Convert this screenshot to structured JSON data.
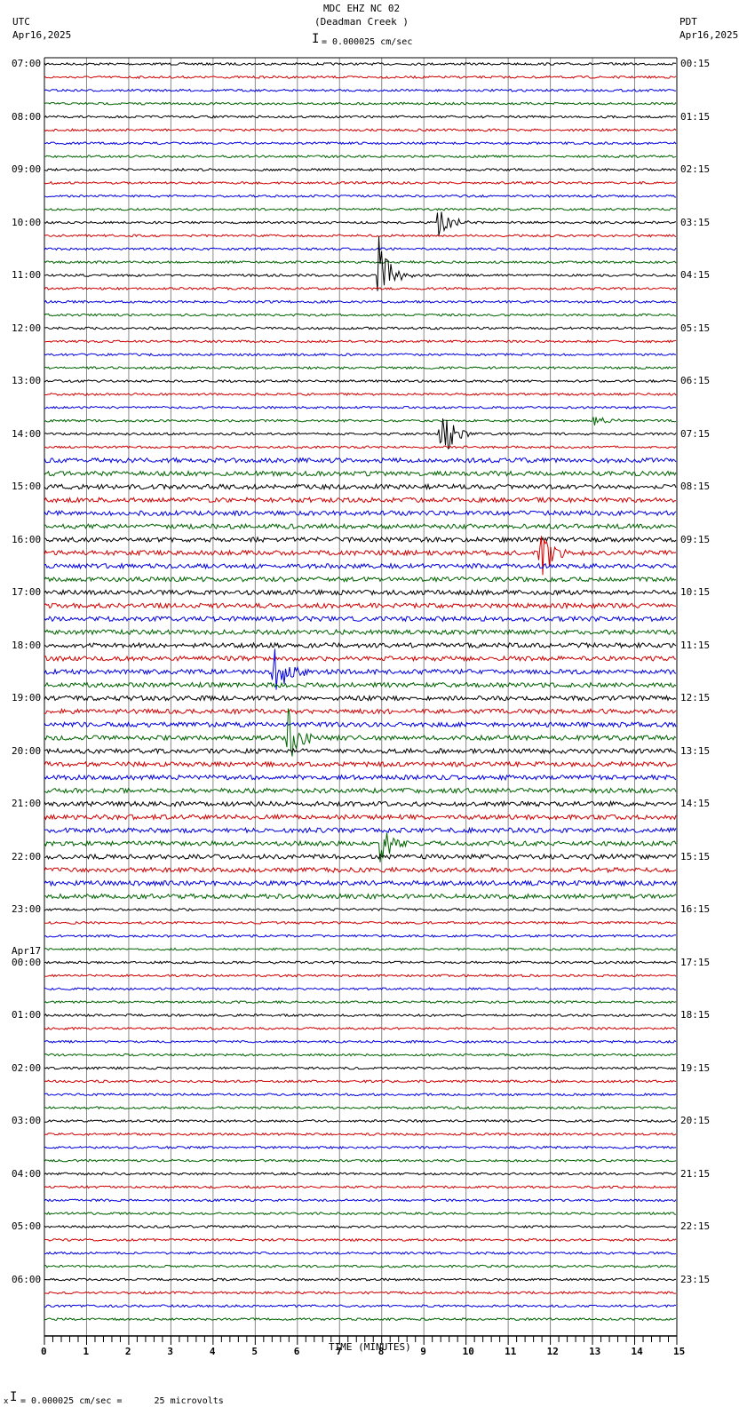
{
  "header": {
    "title": "MDC EHZ NC 02",
    "subtitle": "(Deadman Creek )",
    "left_tz": "UTC",
    "left_date": "Apr16,2025",
    "right_tz": "PDT",
    "right_date": "Apr16,2025",
    "scale": "= 0.000025 cm/sec"
  },
  "footer": {
    "scale": "= 0.000025 cm/sec =      25 microvolts"
  },
  "chart_data": {
    "type": "line",
    "title": "MDC EHZ NC 02 (Deadman Creek )",
    "xlabel": "TIME (MINUTES)",
    "xlim": [
      0,
      15
    ],
    "xticks": [
      "0",
      "1",
      "2",
      "3",
      "4",
      "5",
      "6",
      "7",
      "8",
      "9",
      "10",
      "11",
      "12",
      "13",
      "14",
      "15"
    ],
    "trace_colors": [
      "#000000",
      "#d00000",
      "#0000e0",
      "#006400"
    ],
    "rows_per_hour": 4,
    "left_labels": [
      "07:00",
      "08:00",
      "09:00",
      "10:00",
      "11:00",
      "12:00",
      "13:00",
      "14:00",
      "15:00",
      "16:00",
      "17:00",
      "18:00",
      "19:00",
      "20:00",
      "21:00",
      "22:00",
      "23:00",
      "00:00",
      "01:00",
      "02:00",
      "03:00",
      "04:00",
      "05:00",
      "06:00"
    ],
    "left_date_change": "Apr17",
    "right_labels": [
      "00:15",
      "01:15",
      "02:15",
      "03:15",
      "04:15",
      "05:15",
      "06:15",
      "07:15",
      "08:15",
      "09:15",
      "10:15",
      "11:15",
      "12:15",
      "13:15",
      "14:15",
      "15:15",
      "16:15",
      "17:15",
      "18:15",
      "19:15",
      "20:15",
      "21:15",
      "22:15",
      "23:15"
    ],
    "events": [
      {
        "row": 12,
        "minute": 9.3,
        "amplitude": "medium"
      },
      {
        "row": 16,
        "minute": 7.9,
        "amplitude": "large"
      },
      {
        "row": 27,
        "minute": 13.0,
        "amplitude": "small"
      },
      {
        "row": 28,
        "minute": 9.35,
        "amplitude": "large"
      },
      {
        "row": 37,
        "minute": 11.7,
        "amplitude": "large"
      },
      {
        "row": 46,
        "minute": 5.4,
        "amplitude": "large"
      },
      {
        "row": 51,
        "minute": 5.7,
        "amplitude": "large"
      },
      {
        "row": 59,
        "minute": 7.95,
        "amplitude": "medium"
      }
    ]
  }
}
